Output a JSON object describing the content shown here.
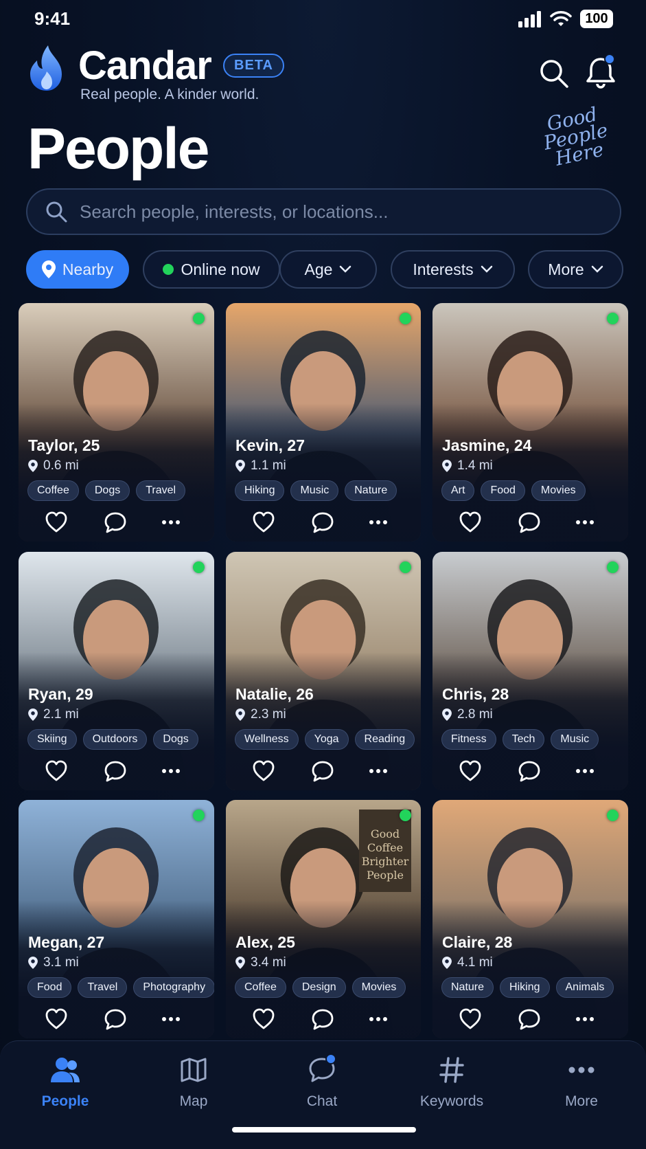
{
  "status": {
    "time": "9:41",
    "battery": "100"
  },
  "brand": {
    "name": "Candar",
    "badge": "BETA",
    "tagline": "Real people. A kinder world."
  },
  "page": {
    "title": "People",
    "badge_lines": [
      "Good",
      "People",
      "Here"
    ]
  },
  "search": {
    "placeholder": "Search people, interests, or locations..."
  },
  "filters": [
    {
      "label": "Nearby",
      "active": true
    },
    {
      "label": "Online now"
    },
    {
      "label": "Age"
    },
    {
      "label": "Interests"
    },
    {
      "label": "More"
    }
  ],
  "people": [
    {
      "name": "Taylor, 25",
      "distance": "0.6 mi",
      "tags": [
        "Coffee",
        "Dogs",
        "Travel"
      ],
      "photo_colors": [
        "#d9cdbb",
        "#6b5444",
        "#2a2320"
      ]
    },
    {
      "name": "Kevin, 27",
      "distance": "1.1 mi",
      "tags": [
        "Hiking",
        "Music",
        "Nature"
      ],
      "photo_colors": [
        "#e6a66a",
        "#4f5d73",
        "#1b2430"
      ]
    },
    {
      "name": "Jasmine, 24",
      "distance": "1.4 mi",
      "tags": [
        "Art",
        "Food",
        "Movies"
      ],
      "photo_colors": [
        "#cbc6bd",
        "#7b5a45",
        "#2b1f1a"
      ]
    },
    {
      "name": "Ryan, 29",
      "distance": "2.1 mi",
      "tags": [
        "Skiing",
        "Outdoors",
        "Dogs"
      ],
      "photo_colors": [
        "#dfe6ec",
        "#7c8791",
        "#1e2328"
      ]
    },
    {
      "name": "Natalie, 26",
      "distance": "2.3 mi",
      "tags": [
        "Wellness",
        "Yoga",
        "Reading"
      ],
      "photo_colors": [
        "#cfc6b4",
        "#9d8a72",
        "#3a3026"
      ]
    },
    {
      "name": "Chris, 28",
      "distance": "2.8 mi",
      "tags": [
        "Fitness",
        "Tech",
        "Music"
      ],
      "photo_colors": [
        "#c8ccd0",
        "#6e6258",
        "#1d1d20"
      ]
    },
    {
      "name": "Megan, 27",
      "distance": "3.1 mi",
      "tags": [
        "Food",
        "Travel",
        "Photography"
      ],
      "photo_colors": [
        "#8fb2d8",
        "#4e6b8a",
        "#1d2533"
      ]
    },
    {
      "name": "Alex, 25",
      "distance": "3.4 mi",
      "tags": [
        "Coffee",
        "Design",
        "Movies"
      ],
      "photo_colors": [
        "#b8a68a",
        "#5a4a3a",
        "#1c1a18"
      ]
    },
    {
      "name": "Claire, 28",
      "distance": "4.1 mi",
      "tags": [
        "Nature",
        "Hiking",
        "Animals"
      ],
      "photo_colors": [
        "#e0a878",
        "#8b7a6a",
        "#262830"
      ]
    }
  ],
  "coffee_sign": "Good Coffee Brighter People",
  "tabs": [
    {
      "label": "People",
      "icon": "people-icon",
      "active": true
    },
    {
      "label": "Map",
      "icon": "map-icon"
    },
    {
      "label": "Chat",
      "icon": "chat-icon"
    },
    {
      "label": "Keywords",
      "icon": "hashtag-icon"
    },
    {
      "label": "More",
      "icon": "more-icon"
    }
  ],
  "colors": {
    "accent": "#3b82f6",
    "online": "#22d35b",
    "background": "#081226"
  }
}
